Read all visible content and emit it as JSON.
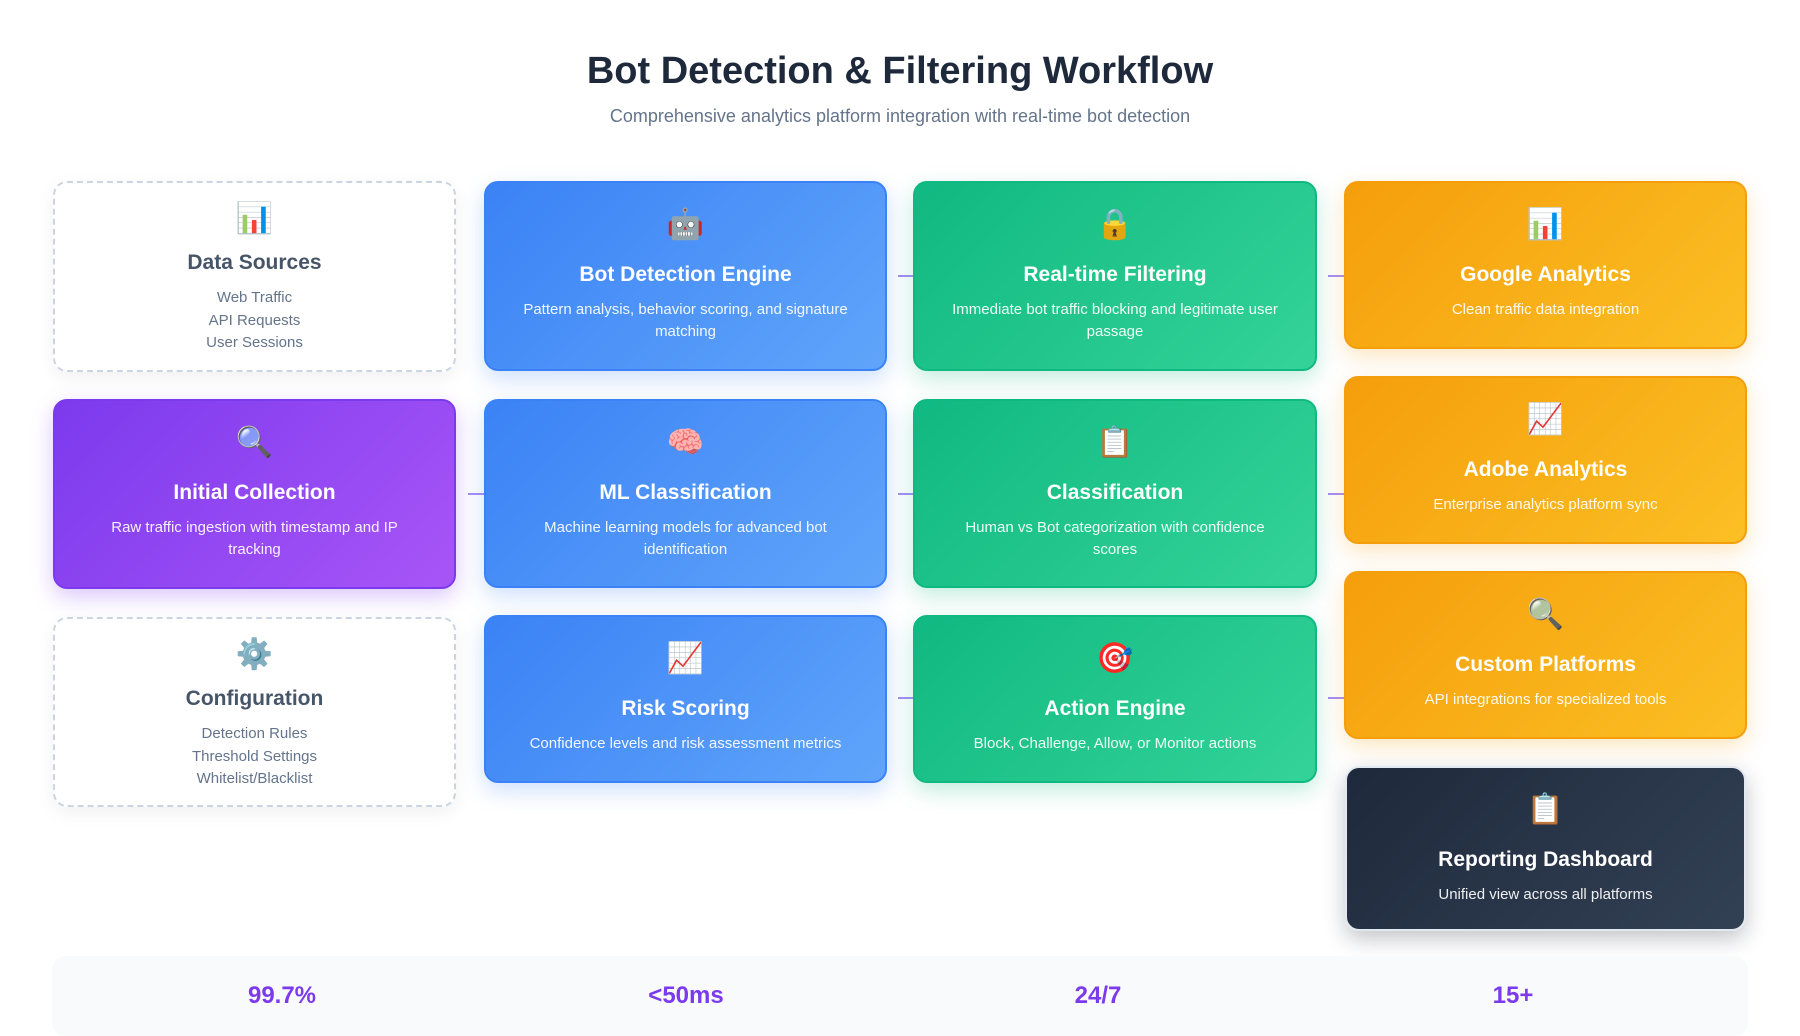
{
  "header": {
    "title": "Bot Detection & Filtering Workflow",
    "subtitle": "Comprehensive analytics platform integration with real-time bot detection"
  },
  "cards": {
    "data_sources": {
      "icon": "📊",
      "icon_name": "bar-chart-icon",
      "title": "Data Sources",
      "lines": [
        "Web Traffic",
        "API Requests",
        "User Sessions"
      ]
    },
    "initial_collection": {
      "icon": "🔍",
      "icon_name": "magnifier-icon",
      "title": "Initial Collection",
      "desc": "Raw traffic ingestion with timestamp and IP tracking"
    },
    "configuration": {
      "icon": "⚙️",
      "icon_name": "gear-icon",
      "title": "Configuration",
      "lines": [
        "Detection Rules",
        "Threshold Settings",
        "Whitelist/Blacklist"
      ]
    },
    "bot_detection_engine": {
      "icon": "🤖",
      "icon_name": "robot-icon",
      "title": "Bot Detection Engine",
      "desc": "Pattern analysis, behavior scoring, and signature matching"
    },
    "ml_classification": {
      "icon": "🧠",
      "icon_name": "brain-icon",
      "title": "ML Classification",
      "desc": "Machine learning models for advanced bot identification"
    },
    "risk_scoring": {
      "icon": "📈",
      "icon_name": "trend-chart-icon",
      "title": "Risk Scoring",
      "desc": "Confidence levels and risk assessment metrics"
    },
    "realtime_filtering": {
      "icon": "🔒",
      "icon_name": "lock-icon",
      "title": "Real-time Filtering",
      "desc": "Immediate bot traffic blocking and legitimate user passage"
    },
    "classification": {
      "icon": "📋",
      "icon_name": "clipboard-icon",
      "title": "Classification",
      "desc": "Human vs Bot categorization with confidence scores"
    },
    "action_engine": {
      "icon": "🎯",
      "icon_name": "target-icon",
      "title": "Action Engine",
      "desc": "Block, Challenge, Allow, or Monitor actions"
    },
    "google_analytics": {
      "icon": "📊",
      "icon_name": "bar-chart-icon",
      "title": "Google Analytics",
      "desc": "Clean traffic data integration"
    },
    "adobe_analytics": {
      "icon": "📈",
      "icon_name": "trend-chart-icon",
      "title": "Adobe Analytics",
      "desc": "Enterprise analytics platform sync"
    },
    "custom_platforms": {
      "icon": "🔍",
      "icon_name": "magnifier-icon",
      "title": "Custom Platforms",
      "desc": "API integrations for specialized tools"
    },
    "reporting_dashboard": {
      "icon": "📋",
      "icon_name": "clipboard-icon",
      "title": "Reporting Dashboard",
      "desc": "Unified view across all platforms"
    }
  },
  "stats": [
    "99.7%",
    "<50ms",
    "24/7",
    "15+"
  ],
  "colors": {
    "blue": "#3b82f6",
    "green": "#10b981",
    "orange": "#f59e0b",
    "purple": "#7c3aed",
    "dark": "#1e293b",
    "stat": "#7c3aed"
  }
}
